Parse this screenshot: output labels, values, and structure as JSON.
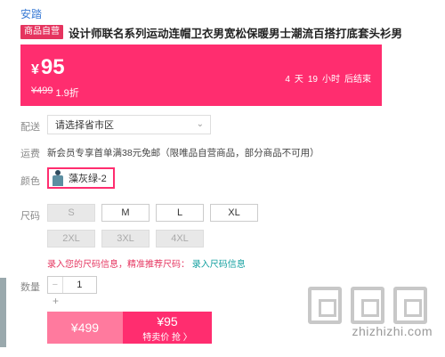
{
  "brand": "安踏",
  "product": {
    "tag": "商品自营",
    "title": "设计师联名系列运动连帽卫衣男宽松保暖男士潮流百搭打底套头衫男"
  },
  "price": {
    "currency": "¥",
    "amount": "95",
    "original": "¥499",
    "discount": "1.9折",
    "countdown": {
      "days": "4",
      "days_unit": "天",
      "hours": "19",
      "hours_unit": "小时",
      "suffix": "后结束"
    }
  },
  "shipping": {
    "label": "配送",
    "region_placeholder": "请选择省市区",
    "fee_label": "运费",
    "fee_text": "新会员专享首单满38元免邮（限唯品自营商品，部分商品不可用）"
  },
  "color": {
    "label": "颜色",
    "selected": "藻灰绿-2"
  },
  "size": {
    "label": "尺码",
    "options": [
      {
        "label": "S",
        "available": false
      },
      {
        "label": "M",
        "available": true
      },
      {
        "label": "L",
        "available": true
      },
      {
        "label": "XL",
        "available": true
      },
      {
        "label": "2XL",
        "available": false
      },
      {
        "label": "3XL",
        "available": false
      },
      {
        "label": "4XL",
        "available": false
      }
    ],
    "hint_red": "录入您的尺码信息，精准推荐尺码：",
    "hint_link": "录入尺码信息"
  },
  "quantity": {
    "label": "数量",
    "minus": "−",
    "value": "1",
    "plus": "+"
  },
  "buy": {
    "left_price": "¥499",
    "right_price": "¥95",
    "right_label": "特卖价 抢 〉"
  },
  "watermark": "zhizhizhi.com",
  "colors": {
    "accent": "#ff2d6f",
    "accent_light": "#ff7a9e",
    "brand_link": "#3a7bd5"
  }
}
